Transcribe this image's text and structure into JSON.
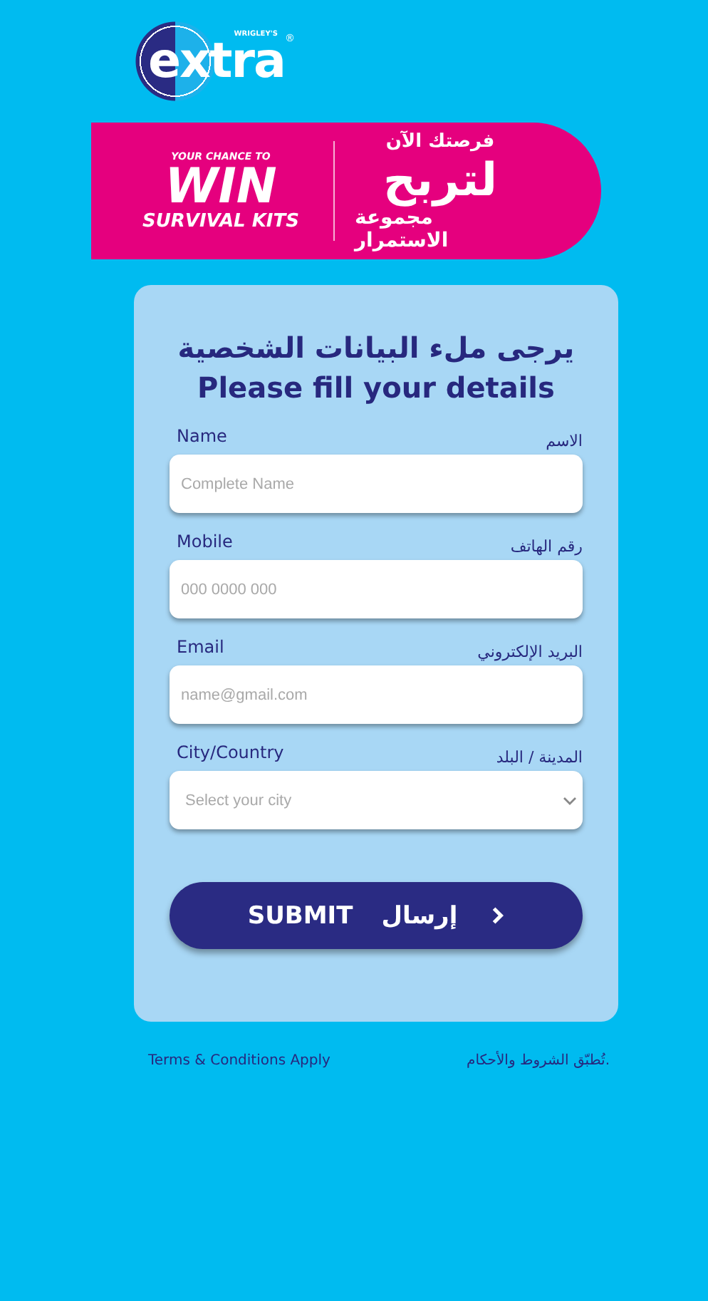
{
  "logo": {
    "brand": "extra",
    "maker": "WRIGLEY'S",
    "mark": "®"
  },
  "banner": {
    "en_small": "YOUR CHANCE TO",
    "en_big": "WIN",
    "en_bottom": "SURVIVAL KITS",
    "ar_small": "فرصتك الآن",
    "ar_big": "لتربح",
    "ar_bottom": "مجموعة الاستمرار"
  },
  "form": {
    "title_ar": "يرجى ملء البيانات الشخصية",
    "title_en": "Please fill your details",
    "fields": [
      {
        "kind": "text",
        "label_en": "Name",
        "label_ar": "الاسم",
        "placeholder": "Complete Name"
      },
      {
        "kind": "text",
        "label_en": "Mobile",
        "label_ar": "رقم الهاتف",
        "placeholder": "000 0000 000"
      },
      {
        "kind": "text",
        "label_en": "Email",
        "label_ar": "البريد الإلكتروني",
        "placeholder": "name@gmail.com"
      },
      {
        "kind": "select",
        "label_en": "City/Country",
        "label_ar": "المدينة / البلد",
        "placeholder": "Select your city"
      }
    ],
    "submit": {
      "en": "SUBMIT",
      "ar": "إرسال"
    }
  },
  "footer": {
    "terms_en": "Terms & Conditions Apply",
    "terms_ar": "تُطبّق الشروط والأحكام."
  }
}
